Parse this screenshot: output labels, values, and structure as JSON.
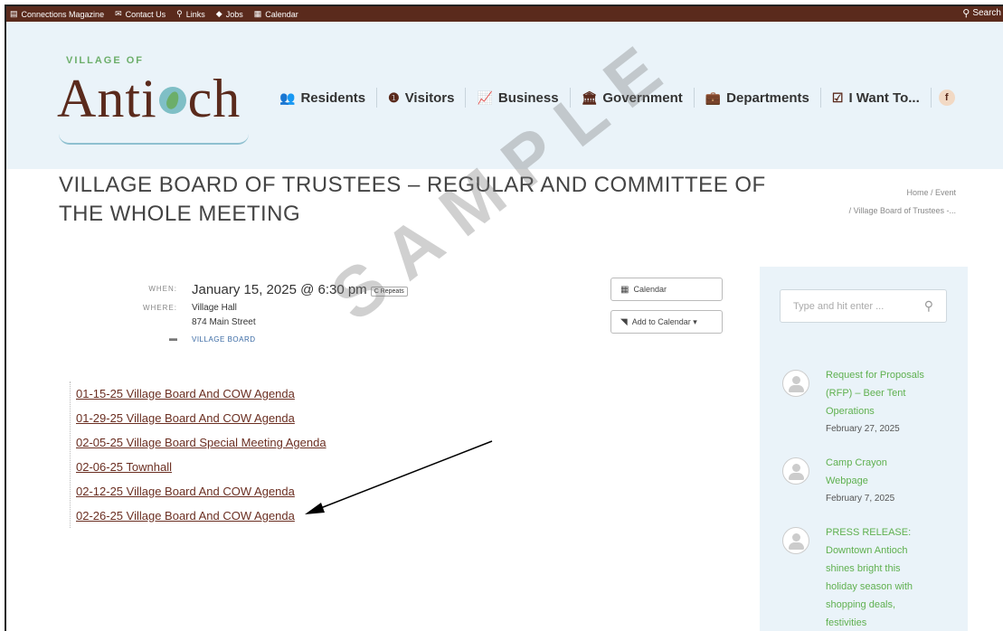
{
  "topbar": {
    "links": [
      {
        "icon": "magazine-icon",
        "glyph": "▤",
        "label": "Connections Magazine"
      },
      {
        "icon": "envelope-icon",
        "glyph": "✉",
        "label": "Contact Us"
      },
      {
        "icon": "link-icon",
        "glyph": "⚲",
        "label": "Links"
      },
      {
        "icon": "handshake-icon",
        "glyph": "◆",
        "label": "Jobs"
      },
      {
        "icon": "calendar-icon",
        "glyph": "▦",
        "label": "Calendar"
      }
    ],
    "search_label": "Search"
  },
  "logo": {
    "village_of": "VILLAGE OF",
    "name_start": "Anti",
    "name_end": "ch"
  },
  "nav": [
    {
      "icon": "residents-icon",
      "glyph": "👥",
      "label": "Residents"
    },
    {
      "icon": "info-icon",
      "glyph": "❶",
      "label": "Visitors"
    },
    {
      "icon": "chart-icon",
      "glyph": "📈",
      "label": "Business"
    },
    {
      "icon": "government-icon",
      "glyph": "🏛",
      "label": "Government"
    },
    {
      "icon": "briefcase-icon",
      "glyph": "💼",
      "label": "Departments"
    },
    {
      "icon": "checkbox-icon",
      "glyph": "☑",
      "label": "I Want To..."
    }
  ],
  "facebook_label": "f",
  "page_title": "VILLAGE BOARD OF TRUSTEES – REGULAR AND COMMITTEE OF THE WHOLE MEETING",
  "breadcrumb": {
    "line1": "Home / Event",
    "line2": "/ Village Board of Trustees -..."
  },
  "event": {
    "when_label": "WHEN:",
    "when_value": "January 15, 2025 @ 6:30 pm",
    "repeats_label": "C Repeats",
    "where_label": "WHERE:",
    "where_line1": "Village Hall",
    "where_line2": "874 Main Street",
    "category": "VILLAGE BOARD"
  },
  "buttons": {
    "calendar": "Calendar",
    "add_to_calendar": "Add to Calendar ▾"
  },
  "agenda_links": [
    "01-15-25 Village Board And COW Agenda",
    "01-29-25 Village Board And COW Agenda",
    "02-05-25 Village Board Special Meeting Agenda",
    "02-06-25 Townhall",
    "02-12-25 Village Board And COW Agenda",
    "02-26-25 Village Board And COW Agenda"
  ],
  "sidebar": {
    "search_placeholder": "Type and hit enter ...",
    "posts": [
      {
        "title": [
          "Request for Proposals",
          "(RFP) – Beer Tent",
          "Operations"
        ],
        "date": "February 27, 2025"
      },
      {
        "title": [
          "Camp Crayon",
          "Webpage"
        ],
        "date": "February 7, 2025"
      },
      {
        "title": [
          "PRESS RELEASE:",
          "Downtown Antioch",
          "shines bright this",
          "holiday season with",
          "shopping deals,",
          "festivities"
        ],
        "date": ""
      }
    ]
  },
  "watermark": "SAMPLE",
  "colors": {
    "topbar": "#5a2a1c",
    "header_bg": "#eaf3f9",
    "link": "#6b2f22",
    "sidebar_title": "#5fb04f"
  }
}
